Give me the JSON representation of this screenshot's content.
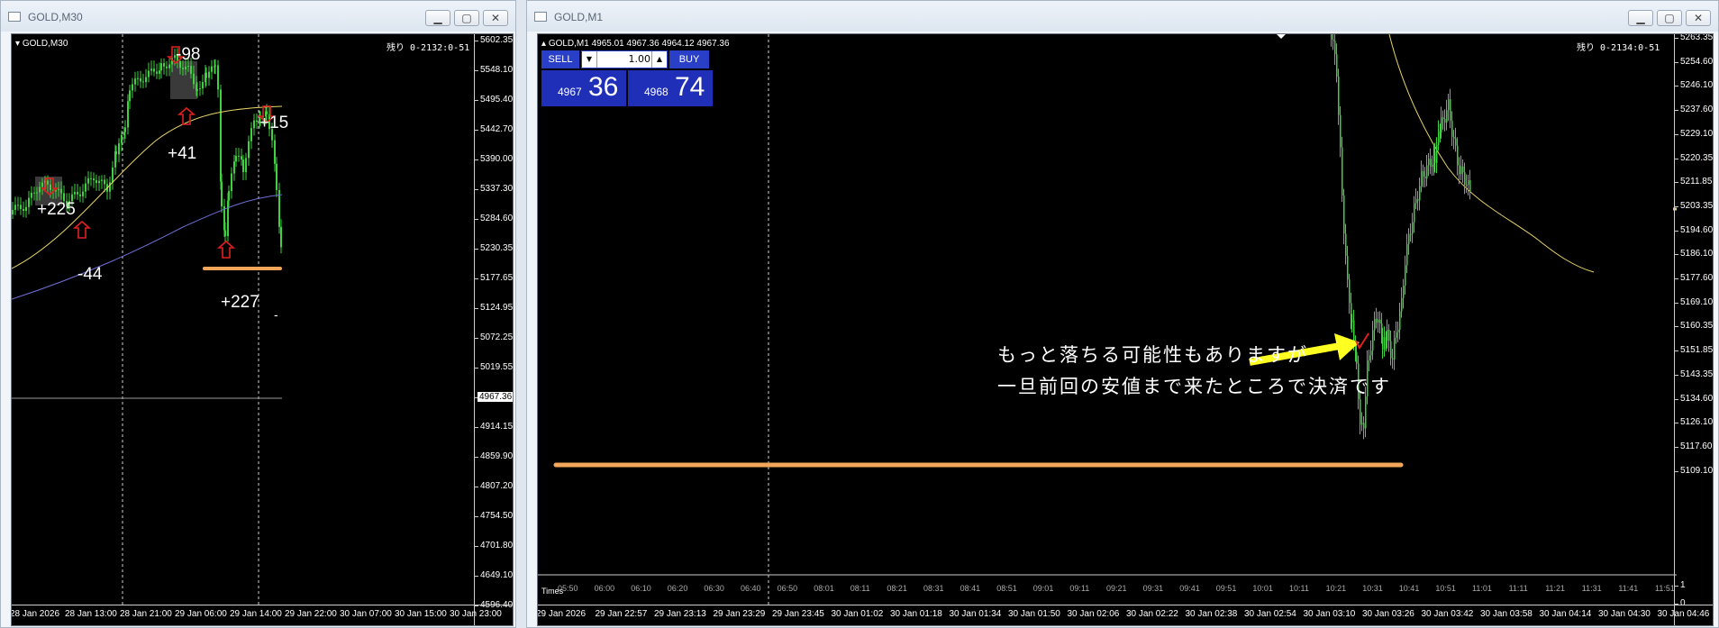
{
  "window_left": {
    "title": "GOLD,M30",
    "chart_label": "GOLD,M30",
    "timer": "残り 0-2132:0-51",
    "current_price": "4967.36",
    "y_labels": [
      "5602.35",
      "5548.10",
      "5495.40",
      "5442.70",
      "5390.00",
      "5337.30",
      "5284.60",
      "5230.35",
      "5177.65",
      "5124.95",
      "5072.25",
      "5019.55",
      "4967.36",
      "4914.15",
      "4859.90",
      "4807.20",
      "4754.50",
      "4701.80",
      "4649.10",
      "4596.40"
    ],
    "x_labels": [
      "28 Jan 2026",
      "28 Jan 13:00",
      "28 Jan 21:00",
      "29 Jan 06:00",
      "29 Jan 14:00",
      "29 Jan 22:00",
      "30 Jan 07:00",
      "30 Jan 15:00",
      "30 Jan 23:00"
    ],
    "trade_labels": [
      "+225",
      "-44",
      "-98",
      "+41",
      "+227",
      "+15",
      "-"
    ]
  },
  "window_right": {
    "title": "GOLD,M1",
    "chart_label": "GOLD,M1  4965.01 4967.36 4964.12 4967.36",
    "timer": "残り 0-2134:0-51",
    "trade_panel": {
      "sell_label": "SELL",
      "buy_label": "BUY",
      "quantity": "1.00",
      "sell_small": "4967",
      "sell_big": "36",
      "buy_small": "4968",
      "buy_big": "74"
    },
    "y_labels": [
      "5263.35",
      "5254.60",
      "5246.10",
      "5237.60",
      "5229.10",
      "5220.35",
      "5211.85",
      "5203.35",
      "5194.60",
      "5186.10",
      "5177.60",
      "5169.10",
      "5160.35",
      "5151.85",
      "5143.35",
      "5134.60",
      "5126.10",
      "5117.60",
      "5109.10"
    ],
    "indicator_label": "Times",
    "indicator_y_labels": [
      "1",
      "0"
    ],
    "indicator_ticks": [
      "05:50",
      "06:00",
      "06:10",
      "06:20",
      "06:30",
      "06:40",
      "06:50",
      "08:01",
      "08:11",
      "08:21",
      "08:31",
      "08:41",
      "08:51",
      "09:01",
      "09:11",
      "09:21",
      "09:31",
      "09:41",
      "09:51",
      "10:01",
      "10:11",
      "10:21",
      "10:31",
      "10:41",
      "10:51",
      "11:01",
      "11:11",
      "11:21",
      "11:31",
      "11:41",
      "11:51"
    ],
    "x_labels": [
      "29 Jan 2026",
      "29 Jan 22:57",
      "29 Jan 23:13",
      "29 Jan 23:29",
      "29 Jan 23:45",
      "30 Jan 01:02",
      "30 Jan 01:18",
      "30 Jan 01:34",
      "30 Jan 01:50",
      "30 Jan 02:06",
      "30 Jan 02:22",
      "30 Jan 02:38",
      "30 Jan 02:54",
      "30 Jan 03:10",
      "30 Jan 03:26",
      "30 Jan 03:42",
      "30 Jan 03:58",
      "30 Jan 04:14",
      "30 Jan 04:30",
      "30 Jan 04:46"
    ],
    "annotation_line1": "もっと落ちる可能性もありますが",
    "annotation_line2": "一旦前回の安値まで来たところで決済です"
  },
  "colors": {
    "candle": "#3fd13f",
    "ma_yellow": "#e8d36a",
    "ma_purple": "#6f6fd8",
    "orange": "#f2a65a",
    "arrow_yellow": "#ffff22",
    "red": "#e02020",
    "panel_blue": "#2a3fc7"
  }
}
